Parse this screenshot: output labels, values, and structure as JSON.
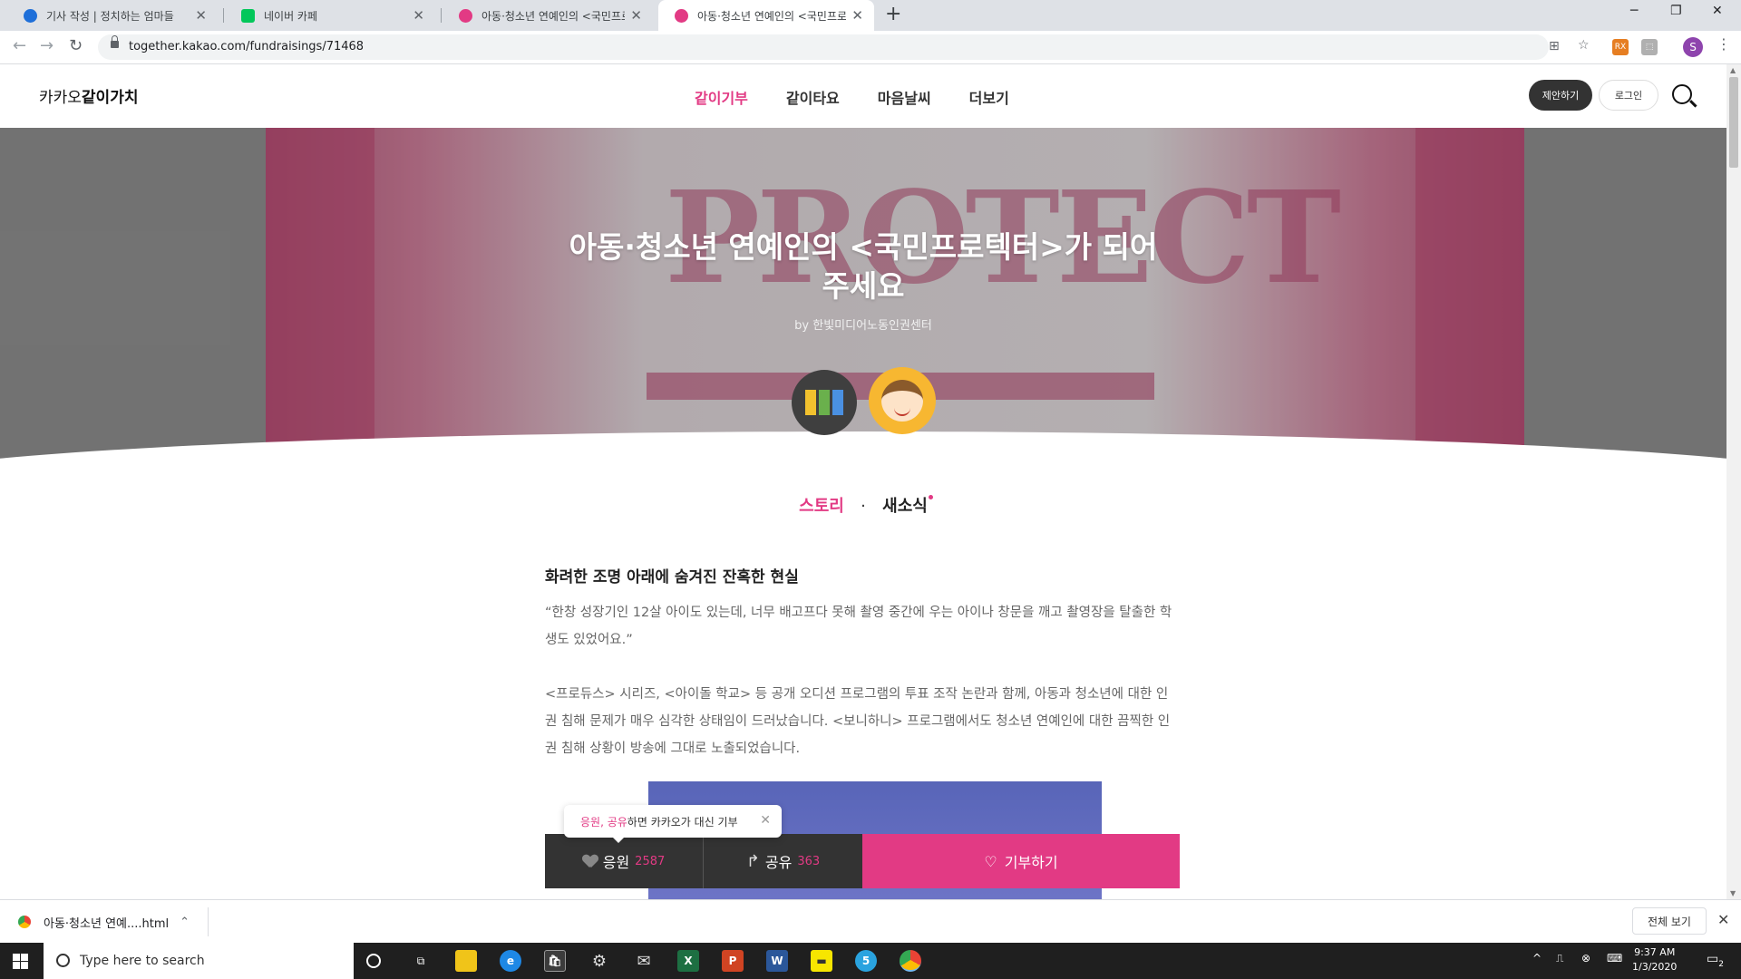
{
  "browser": {
    "tabs": [
      {
        "title": "기사 작성 | 정치하는 엄마들",
        "color": "#1e6fd9"
      },
      {
        "title": "네이버 카페",
        "color": "#03c75a"
      },
      {
        "title": "아동·청소년 연예인의 <국민프로",
        "color": "#e23a84"
      },
      {
        "title": "아동·청소년 연예인의 <국민프로",
        "color": "#e23a84"
      }
    ],
    "url": "together.kakao.com/fundraisings/71468",
    "profile_initial": "S"
  },
  "site": {
    "logo_prefix": "카카오",
    "logo_bold": "같이가치",
    "nav": [
      "같이기부",
      "같이타요",
      "마음날씨",
      "더보기"
    ],
    "propose_label": "제안하기",
    "login_label": "로그인"
  },
  "hero": {
    "title_line1": "아동·청소년 연예인의 <국민프로텍터>가 되어",
    "title_line2": "주세요",
    "by": "by 한빛미디어노동인권센터"
  },
  "content_tabs": {
    "story": "스토리",
    "separator": "·",
    "news": "새소식"
  },
  "article": {
    "heading": "화려한 조명 아래에 숨겨진 잔혹한 현실",
    "quote": "“한창 성장기인 12살 아이도 있는데, 너무 배고프다 못해 촬영 중간에 우는 아이나 창문을 깨고 촬영장을 탈출한 학생도 있었어요.”",
    "body": "<프로듀스> 시리즈, <아이돌 학교> 등 공개 오디션 프로그램의 투표 조작 논란과 함께, 아동과 청소년에 대한 인권 침해 문제가 매우 심각한 상태임이 드러났습니다. <보니하니> 프로그램에서도 청소년 연예인에 대한 끔찍한 인권 침해 상황이 방송에 그대로 노출되었습니다."
  },
  "action_bar": {
    "tooltip_highlight": "응원, 공유",
    "tooltip_text": "하면 카카오가 대신 기부",
    "cheer_label": "응원",
    "cheer_count": "2587",
    "share_label": "공유",
    "share_count": "363",
    "donate_label": "기부하기"
  },
  "download_shelf": {
    "file_name": "아동·청소년 연예....html",
    "show_all": "전체 보기"
  },
  "taskbar": {
    "search_placeholder": "Type here to search",
    "time": "9:37 AM",
    "date": "1/3/2020",
    "notification_count": "2"
  },
  "colors": {
    "accent": "#e23a84",
    "dark_button": "#333333"
  }
}
